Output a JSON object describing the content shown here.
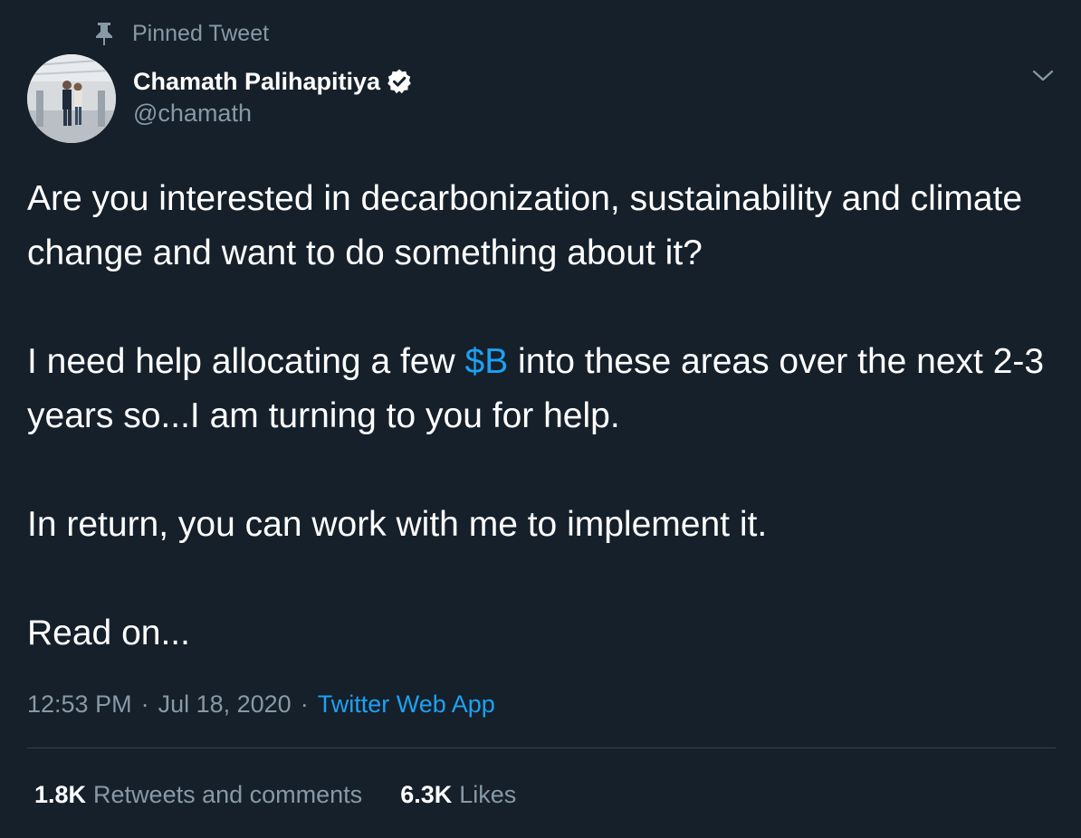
{
  "pinned": {
    "icon": "pin-icon",
    "label": "Pinned Tweet"
  },
  "author": {
    "avatar_icon": "avatar",
    "name": "Chamath Palihapitiya",
    "verified_icon": "verified-badge-icon",
    "handle": "@chamath"
  },
  "menu": {
    "icon": "chevron-down-icon"
  },
  "tweet": {
    "p1": "Are you interested in decarbonization, sustainability and climate change and want to do something about it?",
    "p2_before": "I need help allocating a few ",
    "p2_cashtag": "$B",
    "p2_after": " into these areas over the next 2-3 years so...I am turning to you for help.",
    "p3": "In return, you can work with me to implement it.",
    "p4": "Read on..."
  },
  "meta": {
    "time": "12:53 PM",
    "separator": "·",
    "date": "Jul 18, 2020",
    "source": "Twitter Web App"
  },
  "stats": {
    "retweets_count": "1.8K",
    "retweets_label": "Retweets and comments",
    "likes_count": "6.3K",
    "likes_label": "Likes"
  },
  "colors": {
    "background": "#15202b",
    "secondary_text": "#8899a6",
    "accent": "#1da1f2",
    "divider": "#38444d"
  }
}
